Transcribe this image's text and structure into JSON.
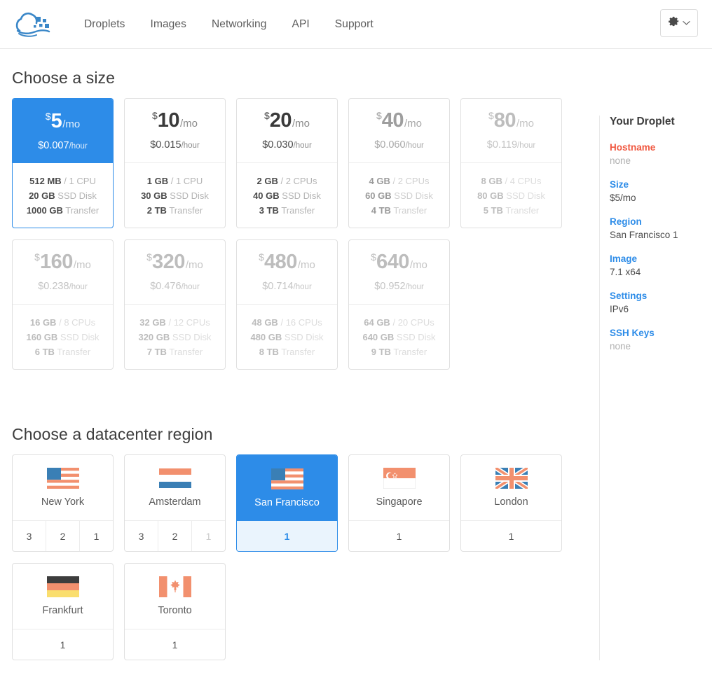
{
  "header": {
    "logo_name": "digitalocean-logo",
    "nav": [
      {
        "label": "Droplets"
      },
      {
        "label": "Images"
      },
      {
        "label": "Networking"
      },
      {
        "label": "API"
      },
      {
        "label": "Support"
      }
    ],
    "account_menu": {
      "icon": "gear-icon",
      "caret": "chevron-down-icon"
    }
  },
  "sections": {
    "size_title": "Choose a size",
    "region_title": "Choose a datacenter region"
  },
  "sizes": [
    {
      "currency": "$",
      "amount": "5",
      "period": "/mo",
      "hourly_price": "$0.007",
      "hourly_unit": "/hour",
      "memory": "512 MB",
      "cpu": "1 CPU",
      "disk": "20 GB",
      "disk_label": "SSD Disk",
      "transfer": "1000 GB",
      "transfer_label": "Transfer",
      "state": "selected"
    },
    {
      "currency": "$",
      "amount": "10",
      "period": "/mo",
      "hourly_price": "$0.015",
      "hourly_unit": "/hour",
      "memory": "1 GB",
      "cpu": "1 CPU",
      "disk": "30 GB",
      "disk_label": "SSD Disk",
      "transfer": "2 TB",
      "transfer_label": "Transfer",
      "state": "normal"
    },
    {
      "currency": "$",
      "amount": "20",
      "period": "/mo",
      "hourly_price": "$0.030",
      "hourly_unit": "/hour",
      "memory": "2 GB",
      "cpu": "2 CPUs",
      "disk": "40 GB",
      "disk_label": "SSD Disk",
      "transfer": "3 TB",
      "transfer_label": "Transfer",
      "state": "normal"
    },
    {
      "currency": "$",
      "amount": "40",
      "period": "/mo",
      "hourly_price": "$0.060",
      "hourly_unit": "/hour",
      "memory": "4 GB",
      "cpu": "2 CPUs",
      "disk": "60 GB",
      "disk_label": "SSD Disk",
      "transfer": "4 TB",
      "transfer_label": "Transfer",
      "state": "dim1"
    },
    {
      "currency": "$",
      "amount": "80",
      "period": "/mo",
      "hourly_price": "$0.119",
      "hourly_unit": "/hour",
      "memory": "8 GB",
      "cpu": "4 CPUs",
      "disk": "80 GB",
      "disk_label": "SSD Disk",
      "transfer": "5 TB",
      "transfer_label": "Transfer",
      "state": "dim2"
    },
    {
      "currency": "$",
      "amount": "160",
      "period": "/mo",
      "hourly_price": "$0.238",
      "hourly_unit": "/hour",
      "memory": "16 GB",
      "cpu": "8 CPUs",
      "disk": "160 GB",
      "disk_label": "SSD Disk",
      "transfer": "6 TB",
      "transfer_label": "Transfer",
      "state": "dim2"
    },
    {
      "currency": "$",
      "amount": "320",
      "period": "/mo",
      "hourly_price": "$0.476",
      "hourly_unit": "/hour",
      "memory": "32 GB",
      "cpu": "12 CPUs",
      "disk": "320 GB",
      "disk_label": "SSD Disk",
      "transfer": "7 TB",
      "transfer_label": "Transfer",
      "state": "dim2"
    },
    {
      "currency": "$",
      "amount": "480",
      "period": "/mo",
      "hourly_price": "$0.714",
      "hourly_unit": "/hour",
      "memory": "48 GB",
      "cpu": "16 CPUs",
      "disk": "480 GB",
      "disk_label": "SSD Disk",
      "transfer": "8 TB",
      "transfer_label": "Transfer",
      "state": "dim2"
    },
    {
      "currency": "$",
      "amount": "640",
      "period": "/mo",
      "hourly_price": "$0.952",
      "hourly_unit": "/hour",
      "memory": "64 GB",
      "cpu": "20 CPUs",
      "disk": "640 GB",
      "disk_label": "SSD Disk",
      "transfer": "9 TB",
      "transfer_label": "Transfer",
      "state": "dim2"
    }
  ],
  "regions": [
    {
      "name": "New York",
      "flag": "flag-us",
      "slots": [
        "3",
        "2",
        "1"
      ],
      "disabled_slots": [],
      "state": "normal"
    },
    {
      "name": "Amsterdam",
      "flag": "flag-nl",
      "slots": [
        "3",
        "2",
        "1"
      ],
      "disabled_slots": [
        2
      ],
      "state": "normal"
    },
    {
      "name": "San Francisco",
      "flag": "flag-us",
      "slots": [
        "1"
      ],
      "disabled_slots": [],
      "state": "selected"
    },
    {
      "name": "Singapore",
      "flag": "flag-sg",
      "slots": [
        "1"
      ],
      "disabled_slots": [],
      "state": "normal"
    },
    {
      "name": "London",
      "flag": "flag-gb",
      "slots": [
        "1"
      ],
      "disabled_slots": [],
      "state": "normal"
    },
    {
      "name": "Frankfurt",
      "flag": "flag-de",
      "slots": [
        "1"
      ],
      "disabled_slots": [],
      "state": "normal"
    },
    {
      "name": "Toronto",
      "flag": "flag-ca",
      "slots": [
        "1"
      ],
      "disabled_slots": [],
      "state": "normal"
    }
  ],
  "summary": {
    "title": "Your Droplet",
    "rows": [
      {
        "label": "Hostname",
        "value": "none",
        "label_state": "alert",
        "value_state": "none"
      },
      {
        "label": "Size",
        "value": "$5/mo",
        "label_state": "link",
        "value_state": "set"
      },
      {
        "label": "Region",
        "value": "San Francisco 1",
        "label_state": "link",
        "value_state": "set"
      },
      {
        "label": "Image",
        "value": "7.1 x64",
        "label_state": "link",
        "value_state": "set"
      },
      {
        "label": "Settings",
        "value": "IPv6",
        "label_state": "link",
        "value_state": "set"
      },
      {
        "label": "SSH Keys",
        "value": "none",
        "label_state": "link",
        "value_state": "none"
      }
    ]
  },
  "colors": {
    "accent_blue": "#2d8ce8",
    "alert_red": "#f0573f",
    "flag_orange": "#f2906e",
    "flag_blue": "#3a7fb5",
    "selected_footer": "#eaf4fd"
  }
}
